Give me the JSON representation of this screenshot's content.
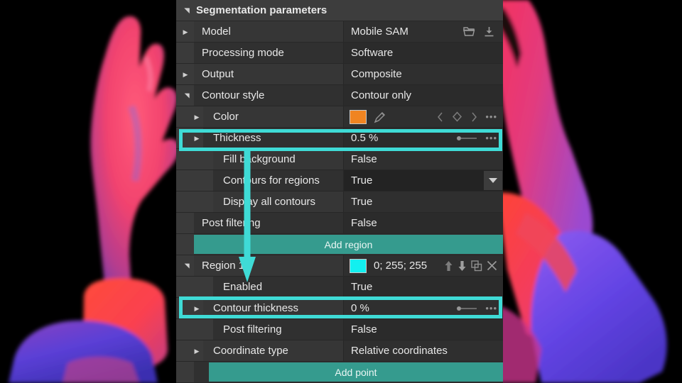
{
  "panel": {
    "header": {
      "label": "Segmentation parameters",
      "expander": "open"
    },
    "rows": [
      {
        "name": "Model",
        "value": "Mobile SAM",
        "indent": 0,
        "expander": "closed",
        "icons": [
          "folder-open-icon",
          "download-icon"
        ]
      },
      {
        "name": "Processing mode",
        "value": "Software",
        "indent": 0,
        "expander": "none"
      },
      {
        "name": "Output",
        "value": "Composite",
        "indent": 0,
        "expander": "closed"
      },
      {
        "name": "Contour style",
        "value": "Contour only",
        "indent": 0,
        "expander": "open"
      },
      {
        "name": "Color",
        "value": "",
        "indent": 1,
        "expander": "closed",
        "swatch": "#F08421",
        "icons": [
          "eyedropper-icon",
          "prev-keyframe-icon",
          "keyframe-diamond-icon",
          "next-keyframe-icon",
          "more-options-icon"
        ]
      },
      {
        "name": "Thickness",
        "value": "0.5 %",
        "indent": 1,
        "expander": "closed",
        "icons": [
          "slider-icon",
          "more-options-icon"
        ],
        "highlighted": true
      },
      {
        "name": "Fill background",
        "value": "False",
        "indent": 2,
        "expander": "none"
      },
      {
        "name": "Contours for regions",
        "value": "True",
        "indent": 2,
        "expander": "none",
        "icons": [
          "dropdown-chevron-icon"
        ]
      },
      {
        "name": "Display all contours",
        "value": "True",
        "indent": 2,
        "expander": "none"
      },
      {
        "name": "Post filtering",
        "value": "False",
        "indent": 0,
        "expander": "none"
      }
    ],
    "add_region_button": {
      "label": "Add region"
    },
    "region_row": {
      "name": "Region 1",
      "expander": "open",
      "swatch": "#12F0F0",
      "value": "0; 255; 255",
      "icons": [
        "move-up-icon",
        "move-down-icon",
        "duplicate-icon",
        "delete-icon"
      ]
    },
    "region_rows": [
      {
        "name": "Enabled",
        "value": "True",
        "indent": 2,
        "expander": "none"
      },
      {
        "name": "Contour thickness",
        "value": "0 %",
        "indent": 1,
        "expander": "closed",
        "icons": [
          "slider-icon",
          "more-options-icon"
        ],
        "highlighted": true
      },
      {
        "name": "Post filtering",
        "value": "False",
        "indent": 2,
        "expander": "none"
      },
      {
        "name": "Coordinate type",
        "value": "Relative coordinates",
        "indent": 1,
        "expander": "closed"
      }
    ],
    "add_point_button": {
      "label": "Add point"
    }
  },
  "annotations": {
    "highlight_color": "#3FDBD6",
    "arrow_color": "#3FDBD6",
    "highlight_targets": [
      "Thickness",
      "Contour thickness"
    ],
    "arrow": {
      "from": "Thickness",
      "to": "Contour thickness"
    }
  },
  "colors": {
    "panel_background": "#323232",
    "row_name_background": "#363636",
    "row_value_background": "#2E2E2E",
    "accent_teal": "#359B8E",
    "annotation_cyan": "#3FDBD6",
    "contour_color_swatch": "#F08421",
    "region_color_swatch": "#12F0F0"
  }
}
